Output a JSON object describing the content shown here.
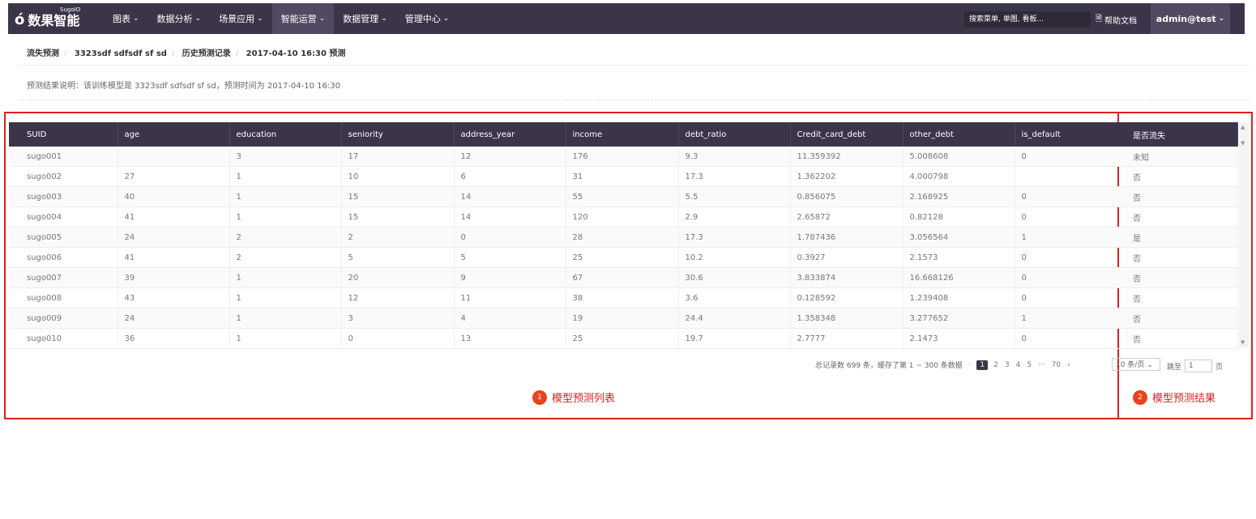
{
  "app": {
    "logo_text": "数果智能",
    "logo_small": "SugoIO"
  },
  "nav": [
    {
      "label": "图表"
    },
    {
      "label": "数据分析"
    },
    {
      "label": "场景应用"
    },
    {
      "label": "智能运营"
    },
    {
      "label": "数据管理"
    },
    {
      "label": "管理中心"
    }
  ],
  "search": {
    "placeholder": "搜索菜单, 单图, 看板..."
  },
  "help": {
    "label": "帮助文档"
  },
  "user": {
    "label": "admin@test"
  },
  "breadcrumb": [
    "流失预测",
    "3323sdf sdfsdf sf sd",
    "历史预测记录",
    "2017-04-10 16:30 预测"
  ],
  "description": "预测结果说明：该训练模型是 3323sdf sdfsdf sf sd，预测时间为 2017-04-10 16:30",
  "table": {
    "columns": [
      "SUID",
      "age",
      "education",
      "seniority",
      "address_year",
      "income",
      "debt_ratio",
      "Credit_card_debt",
      "other_debt",
      "is_default"
    ],
    "rows": [
      [
        "sugo001",
        "",
        "3",
        "17",
        "12",
        "176",
        "9.3",
        "11.359392",
        "5.008608",
        "0"
      ],
      [
        "sugo002",
        "27",
        "1",
        "10",
        "6",
        "31",
        "17.3",
        "1.362202",
        "4.000798",
        ""
      ],
      [
        "sugo003",
        "40",
        "1",
        "15",
        "14",
        "55",
        "5.5",
        "0.856075",
        "2.168925",
        "0"
      ],
      [
        "sugo004",
        "41",
        "1",
        "15",
        "14",
        "120",
        "2.9",
        "2.65872",
        "0.82128",
        "0"
      ],
      [
        "sugo005",
        "24",
        "2",
        "2",
        "0",
        "28",
        "17.3",
        "1.787436",
        "3.056564",
        "1"
      ],
      [
        "sugo006",
        "41",
        "2",
        "5",
        "5",
        "25",
        "10.2",
        "0.3927",
        "2.1573",
        "0"
      ],
      [
        "sugo007",
        "39",
        "1",
        "20",
        "9",
        "67",
        "30.6",
        "3.833874",
        "16.668126",
        "0"
      ],
      [
        "sugo008",
        "43",
        "1",
        "12",
        "11",
        "38",
        "3.6",
        "0.128592",
        "1.239408",
        "0"
      ],
      [
        "sugo009",
        "24",
        "1",
        "3",
        "4",
        "19",
        "24.4",
        "1.358348",
        "3.277652",
        "1"
      ],
      [
        "sugo010",
        "36",
        "1",
        "0",
        "13",
        "25",
        "19.7",
        "2.7777",
        "2.1473",
        "0"
      ]
    ]
  },
  "result": {
    "header": "是否流失",
    "values": [
      "未知",
      "否",
      "否",
      "否",
      "是",
      "否",
      "否",
      "否",
      "否",
      "否"
    ]
  },
  "pagination": {
    "summary": "总记录数 699 条，缓存了第 1 ~ 300 条数据",
    "pages": [
      "1",
      "2",
      "3",
      "4",
      "5"
    ],
    "ellipsis": "···",
    "last": "70",
    "page_size": "10 条/页",
    "jump_label": "跳至",
    "jump_value": "1",
    "page_unit": "页"
  },
  "annotations": [
    {
      "num": "1",
      "label": "模型预测列表"
    },
    {
      "num": "2",
      "label": "模型预测结果"
    }
  ]
}
